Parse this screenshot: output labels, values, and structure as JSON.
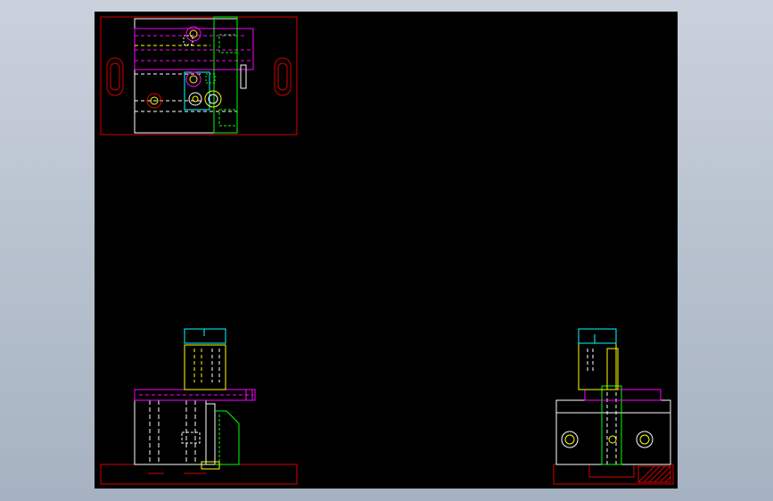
{
  "app": {
    "kind": "CAD model space viewer"
  },
  "colors": {
    "background_outer": "#b7c1ce",
    "viewport": "#000000",
    "border": "#d40000",
    "magenta": "#ff00ff",
    "white": "#ffffff",
    "yellow": "#ffff00",
    "green": "#00ff00",
    "cyan": "#00ffff",
    "hatch": "#d40000"
  },
  "views": [
    {
      "name": "top-view",
      "label": ""
    },
    {
      "name": "front-view",
      "label": ""
    },
    {
      "name": "side-view",
      "label": ""
    }
  ]
}
